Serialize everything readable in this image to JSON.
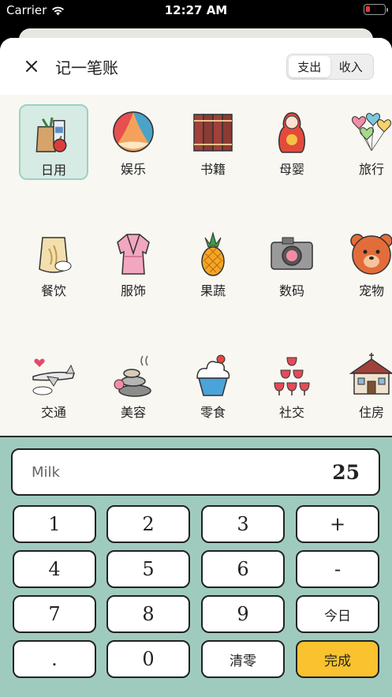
{
  "status": {
    "carrier": "Carrier",
    "time": "12:27 AM"
  },
  "header": {
    "title": "记一笔账",
    "tabs": [
      "支出",
      "收入"
    ],
    "active_tab": "支出"
  },
  "categories": [
    {
      "label": "日用",
      "icon": "groceries-bag-icon",
      "selected": true
    },
    {
      "label": "娱乐",
      "icon": "beach-ball-icon"
    },
    {
      "label": "书籍",
      "icon": "books-icon"
    },
    {
      "label": "母婴",
      "icon": "matryoshka-doll-icon"
    },
    {
      "label": "旅行",
      "icon": "heart-balloons-icon"
    },
    {
      "label": "餐饮",
      "icon": "rice-sack-icon"
    },
    {
      "label": "服饰",
      "icon": "bathrobe-icon"
    },
    {
      "label": "果蔬",
      "icon": "pineapple-icon"
    },
    {
      "label": "数码",
      "icon": "camera-icon"
    },
    {
      "label": "宠物",
      "icon": "bear-face-icon"
    },
    {
      "label": "交通",
      "icon": "airplane-icon"
    },
    {
      "label": "美容",
      "icon": "spa-stones-icon"
    },
    {
      "label": "零食",
      "icon": "cupcake-icon"
    },
    {
      "label": "社交",
      "icon": "wine-glasses-icon"
    },
    {
      "label": "住房",
      "icon": "house-icon"
    }
  ],
  "entry": {
    "note": "Milk",
    "amount": "25"
  },
  "keys": [
    "1",
    "2",
    "3",
    "+",
    "4",
    "5",
    "6",
    "-",
    "7",
    "8",
    "9",
    "今日",
    ".",
    "0",
    "清零",
    "完成"
  ],
  "colors": {
    "keypad_bg": "#9fcbbf",
    "done_button": "#f9c22e",
    "selected_bg": "#d7ebe5"
  }
}
